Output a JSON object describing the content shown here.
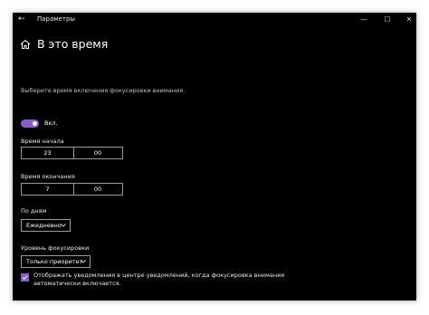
{
  "window": {
    "title": "Параметры",
    "minimize_glyph": "—",
    "maximize_glyph": "☐",
    "close_glyph": "✕",
    "back_glyph": "←"
  },
  "page": {
    "heading": "В это время",
    "subtitle": "Выберите время включения фокусировки внимания."
  },
  "toggle": {
    "label": "Вкл.",
    "on": true,
    "color": "#8a5cc8"
  },
  "start_time": {
    "label": "Время начала",
    "hours": "23",
    "minutes": "00"
  },
  "end_time": {
    "label": "Время окончания",
    "hours": "7",
    "minutes": "00"
  },
  "repeat": {
    "label": "По дням",
    "value": "Ежедневно"
  },
  "focus_level": {
    "label": "Уровень фокусировки",
    "value": "Только приоритет"
  },
  "notification_checkbox": {
    "checked": true,
    "text": "Отображать уведомления в центре уведомлений, когда фокусировка внимания автоматически включается."
  },
  "icons": {
    "back": "back-arrow-icon",
    "home": "home-icon",
    "chevron": "chevron-down-icon",
    "check": "checkmark-icon"
  },
  "colors": {
    "accent": "#8a5cc8",
    "background": "#000000"
  }
}
